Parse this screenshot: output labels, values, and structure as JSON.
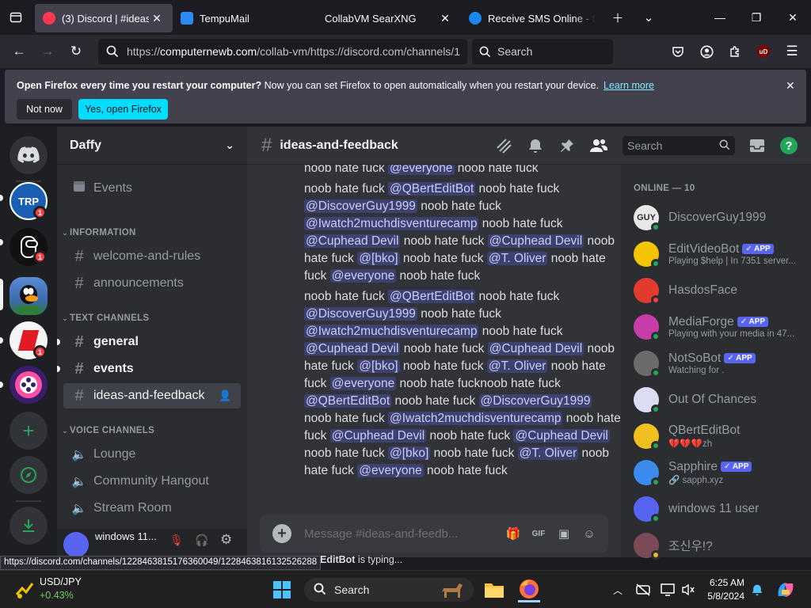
{
  "browser": {
    "tabs": [
      {
        "title": "(3) Discord | #ideas-and-",
        "active": true,
        "favicon_color": "#ff3750"
      },
      {
        "title": "TempuMail",
        "active": false,
        "favicon_color": "#2a8bf2"
      },
      {
        "title": "CollabVM SearXNG",
        "active": false,
        "favicon_color": ""
      },
      {
        "title": "Receive SMS Online - S",
        "active": false,
        "favicon_color": "#1d87f0"
      }
    ],
    "url_prefix": "https://",
    "url_domain": "computernewb.com",
    "url_rest": "/collab-vm/https://discord.com/channels/1",
    "search_placeholder": "Search",
    "notification": {
      "bold": "Open Firefox every time you restart your computer?",
      "text": " Now you can set Firefox to open automatically when you restart your device.",
      "link": "Learn more",
      "not_now": "Not now",
      "yes": "Yes, open Firefox"
    },
    "status_url": "https://discord.com/channels/1228463815176360049/1228463816132526288"
  },
  "discord": {
    "server_name": "Daffy",
    "servers": [
      {
        "label": "TRP",
        "badge": "1",
        "color": "#1a5fb4"
      },
      {
        "label": "",
        "badge": "1",
        "color": "#111111"
      },
      {
        "label": "",
        "badge": "",
        "color": "#3d6bb0"
      },
      {
        "label": "",
        "badge": "1",
        "color": "#f5f5f5"
      },
      {
        "label": "",
        "badge": "",
        "color": "#3a1e6b"
      }
    ],
    "events_label": "Events",
    "categories": {
      "information": "INFORMATION",
      "text": "TEXT CHANNELS",
      "voice": "VOICE CHANNELS"
    },
    "info_channels": [
      "welcome-and-rules",
      "announcements"
    ],
    "text_channels": [
      "general",
      "events",
      "ideas-and-feedback"
    ],
    "voice_channels": [
      "Lounge",
      "Community Hangout",
      "Stream Room"
    ],
    "user_name": "windows 11...",
    "channel_name": "ideas-and-feedback",
    "search_placeholder": "Search",
    "composer_placeholder": "Message #ideas-and-feedb...",
    "typing_user": "EditBot",
    "typing_suffix": " is typing...",
    "messages": [
      [
        {
          "t": "noob hate fuck "
        },
        {
          "m": "@everyone"
        },
        {
          "t": " noob hate fuck"
        }
      ],
      [
        {
          "t": "noob hate fuck "
        },
        {
          "m": "@QBertEditBot"
        },
        {
          "t": " noob hate fuck "
        },
        {
          "m": "@DiscoverGuy1999"
        },
        {
          "t": " noob hate fuck "
        },
        {
          "m": "@Iwatch2muchdisventurecamp"
        },
        {
          "t": " noob hate fuck "
        },
        {
          "m": "@Cuphead Devil"
        },
        {
          "t": " noob hate fuck "
        },
        {
          "m": "@Cuphead Devil"
        },
        {
          "t": " noob hate fuck "
        },
        {
          "m": "@[bko]"
        },
        {
          "t": " noob hate fuck "
        },
        {
          "m": "@T. Oliver"
        },
        {
          "t": " noob hate fuck "
        },
        {
          "m": "@everyone"
        },
        {
          "t": " noob hate fuck"
        }
      ],
      [
        {
          "t": "noob hate fuck "
        },
        {
          "m": "@QBertEditBot"
        },
        {
          "t": " noob hate fuck "
        },
        {
          "m": "@DiscoverGuy1999"
        },
        {
          "t": " noob hate fuck "
        },
        {
          "m": "@Iwatch2muchdisventurecamp"
        },
        {
          "t": " noob hate fuck "
        },
        {
          "m": "@Cuphead Devil"
        },
        {
          "t": " noob hate fuck "
        },
        {
          "m": "@Cuphead Devil"
        },
        {
          "t": " noob hate fuck "
        },
        {
          "m": "@[bko]"
        },
        {
          "t": " noob hate fuck "
        },
        {
          "m": "@T. Oliver"
        },
        {
          "t": " noob hate fuck "
        },
        {
          "m": "@everyone"
        },
        {
          "t": " noob hate fucknoob hate fuck "
        },
        {
          "m": "@QBertEditBot"
        },
        {
          "t": " noob hate fuck "
        },
        {
          "m": "@DiscoverGuy1999"
        },
        {
          "t": " noob hate fuck "
        },
        {
          "m": "@Iwatch2muchdisventurecamp"
        },
        {
          "t": " noob hate fuck "
        },
        {
          "m": "@Cuphead Devil"
        },
        {
          "t": " noob hate fuck "
        },
        {
          "m": "@Cuphead Devil"
        },
        {
          "t": " noob hate fuck "
        },
        {
          "m": "@[bko]"
        },
        {
          "t": " noob hate fuck "
        },
        {
          "m": "@T. Oliver"
        },
        {
          "t": " noob hate fuck "
        },
        {
          "m": "@everyone"
        },
        {
          "t": " noob hate fuck"
        }
      ]
    ],
    "online_header": "ONLINE — 10",
    "app_tag": "✓ APP",
    "members": [
      {
        "name": "DiscoverGuy1999",
        "activity": "",
        "app": false,
        "status": "online",
        "color": "#e8e8e8",
        "initials": "GUY"
      },
      {
        "name": "EditVideoBot",
        "activity": "Playing $help | In 7351 server...",
        "app": true,
        "status": "online",
        "color": "#f5c400",
        "initials": ""
      },
      {
        "name": "HasdosFace",
        "activity": "",
        "app": false,
        "status": "dnd",
        "color": "#e23b2e",
        "initials": ""
      },
      {
        "name": "MediaForge",
        "activity": "Playing with your media in 47...",
        "app": true,
        "status": "online",
        "color": "#c83ea8",
        "initials": ""
      },
      {
        "name": "NotSoBot",
        "activity": "Watching for .",
        "app": true,
        "status": "online",
        "color": "#6b6b6b",
        "initials": ""
      },
      {
        "name": "Out Of Chances",
        "activity": "",
        "app": false,
        "status": "online",
        "color": "#dcdcf5",
        "initials": ""
      },
      {
        "name": "QBertEditBot",
        "activity": "💔💔💔zh",
        "app": false,
        "status": "online",
        "color": "#f0c020",
        "initials": ""
      },
      {
        "name": "Sapphire",
        "activity": "🔗 sapph.xyz",
        "app": true,
        "status": "online",
        "color": "#3c8cf0",
        "initials": ""
      },
      {
        "name": "windows 11 user",
        "activity": "",
        "app": false,
        "status": "online",
        "color": "#5865f2",
        "initials": ""
      },
      {
        "name": "조신우!?",
        "activity": "",
        "app": false,
        "status": "idle",
        "color": "#7a4a55",
        "initials": ""
      }
    ]
  },
  "taskbar": {
    "ticker_name": "USD/JPY",
    "ticker_change": "+0.43%",
    "search_label": "Search",
    "time": "6:25 AM",
    "date": "5/8/2024"
  }
}
